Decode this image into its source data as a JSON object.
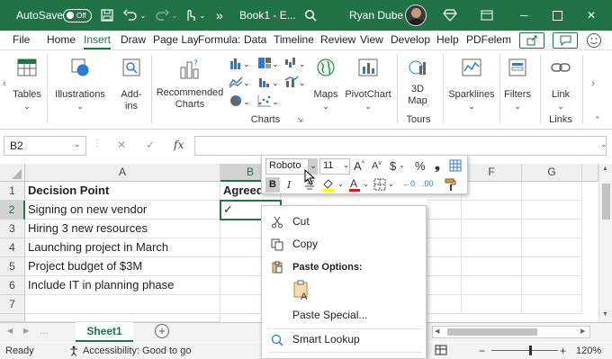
{
  "titlebar": {
    "autosave_label": "AutoSave",
    "autosave_state": "Off",
    "doc_title": "Book1 - E...",
    "user_name": "Ryan Dube",
    "more_label": "»",
    "bg_color": "#217346"
  },
  "menu": {
    "tabs": [
      "File",
      "Home",
      "Insert",
      "Draw",
      "Page Lay",
      "Formula:",
      "Data",
      "Timeline",
      "Review",
      "View",
      "Develop",
      "Help",
      "PDFelem"
    ],
    "active": "Insert"
  },
  "ribbon": {
    "tables": "Tables",
    "illustrations": "Illustrations",
    "addins_1": "Add-",
    "addins_2": "ins",
    "recommended_1": "Recommended",
    "recommended_2": "Charts",
    "charts_group": "Charts",
    "maps": "Maps",
    "pivotchart": "PivotChart",
    "map3d_1": "3D",
    "map3d_2": "Map",
    "tours": "Tours",
    "sparklines": "Sparklines",
    "filters": "Filters",
    "link": "Link",
    "links_group": "Links"
  },
  "formula": {
    "name_box": "B2",
    "fx": "fx",
    "cancel": "✕",
    "enter": "✓",
    "value": ""
  },
  "grid": {
    "columns": [
      "A",
      "B",
      "C",
      "D",
      "E",
      "F",
      "G"
    ],
    "rows": [
      "1",
      "2",
      "3",
      "4",
      "5",
      "6",
      "7"
    ],
    "col_a": [
      "Decision Point",
      "Signing on new vendor",
      "Hiring 3 new resources",
      "Launching project in March",
      "Project budget of $3M",
      "Include IT in planning phase",
      ""
    ],
    "b1": "Agreed",
    "b2": "✓"
  },
  "mini_toolbar": {
    "font": "Roboto",
    "size": "11",
    "grow": "A",
    "shrink": "A",
    "currency": "$",
    "percent": "%",
    "comma": "❟",
    "bold": "B",
    "italic": "I",
    "dec_inc": "←0",
    "dec_dec": ".00"
  },
  "context_menu": {
    "cut": "Cut",
    "copy": "Copy",
    "paste_options": "Paste Options:",
    "paste_special": "Paste Special...",
    "smart_lookup": "Smart Lookup"
  },
  "sheet_tabs": {
    "active": "Sheet1",
    "add": "+"
  },
  "status": {
    "ready": "Ready",
    "accessibility": "Accessibility: Good to go",
    "zoom_pct": "120%",
    "zoom_minus": "−",
    "zoom_plus": "+"
  },
  "colors": {
    "accent": "#217346",
    "selection": "#217346"
  }
}
